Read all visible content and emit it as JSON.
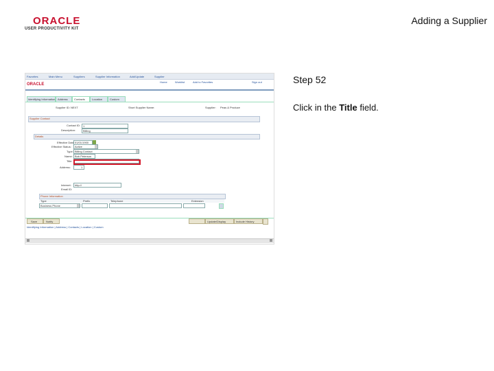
{
  "slide": {
    "title": "Adding a Supplier",
    "step": "Step 52",
    "instruction_prefix": "Click in the",
    "instruction_bold": "Title",
    "instruction_suffix": "field."
  },
  "logo": {
    "brand": "ORACLE",
    "product": "USER PRODUCTIVITY KIT"
  },
  "app": {
    "breadcrumb": [
      "Favorites",
      "Main Menu",
      "Suppliers",
      "Supplier Information",
      "Add/Update",
      "Supplier"
    ],
    "top_links": [
      "Home",
      "Worklist",
      "Add to Favorites",
      "Sign out"
    ],
    "brand": "ORACLE",
    "tabs": [
      "Identifying Information",
      "Address",
      "Contacts",
      "Location",
      "Custom"
    ],
    "supplier_id_label": "Supplier ID:",
    "supplier_id_value": "NEXT",
    "short_name_label": "Short Supplier Name:",
    "supplier_label": "Supplier:",
    "supplier_value": "Peas & Produce",
    "section_title": "Supplier Contact",
    "contact_id_label": "Contact ID:",
    "contact_id_value": "1",
    "description_label": "Description:",
    "description_value": "Billing",
    "details_title": "Details",
    "effective_date_label": "Effective Date:",
    "effective_date_value": "01/01/1900",
    "status_label": "Effective Status:",
    "status_value": "Active",
    "type_label": "Type:",
    "type_value": "Billing Contact",
    "name_label": "Name:",
    "name_value": "Bob Peterson",
    "title_label": "Title:",
    "title_value": "",
    "address_label": "Address:",
    "address_value": "1",
    "internet_label": "Internet:",
    "internet_value": "http://",
    "email_label": "Email ID:",
    "phone_title": "Phone Information",
    "phone_cols": [
      "Type",
      "Prefix",
      "Telephone",
      "Extension"
    ],
    "phone_row_type": "Business Phone",
    "buttons": [
      "Save",
      "Notify",
      "Update/Display",
      "Include History",
      "Correct History"
    ],
    "footer_links": "Identifying Information | Address | Contacts | Location | Custom"
  }
}
